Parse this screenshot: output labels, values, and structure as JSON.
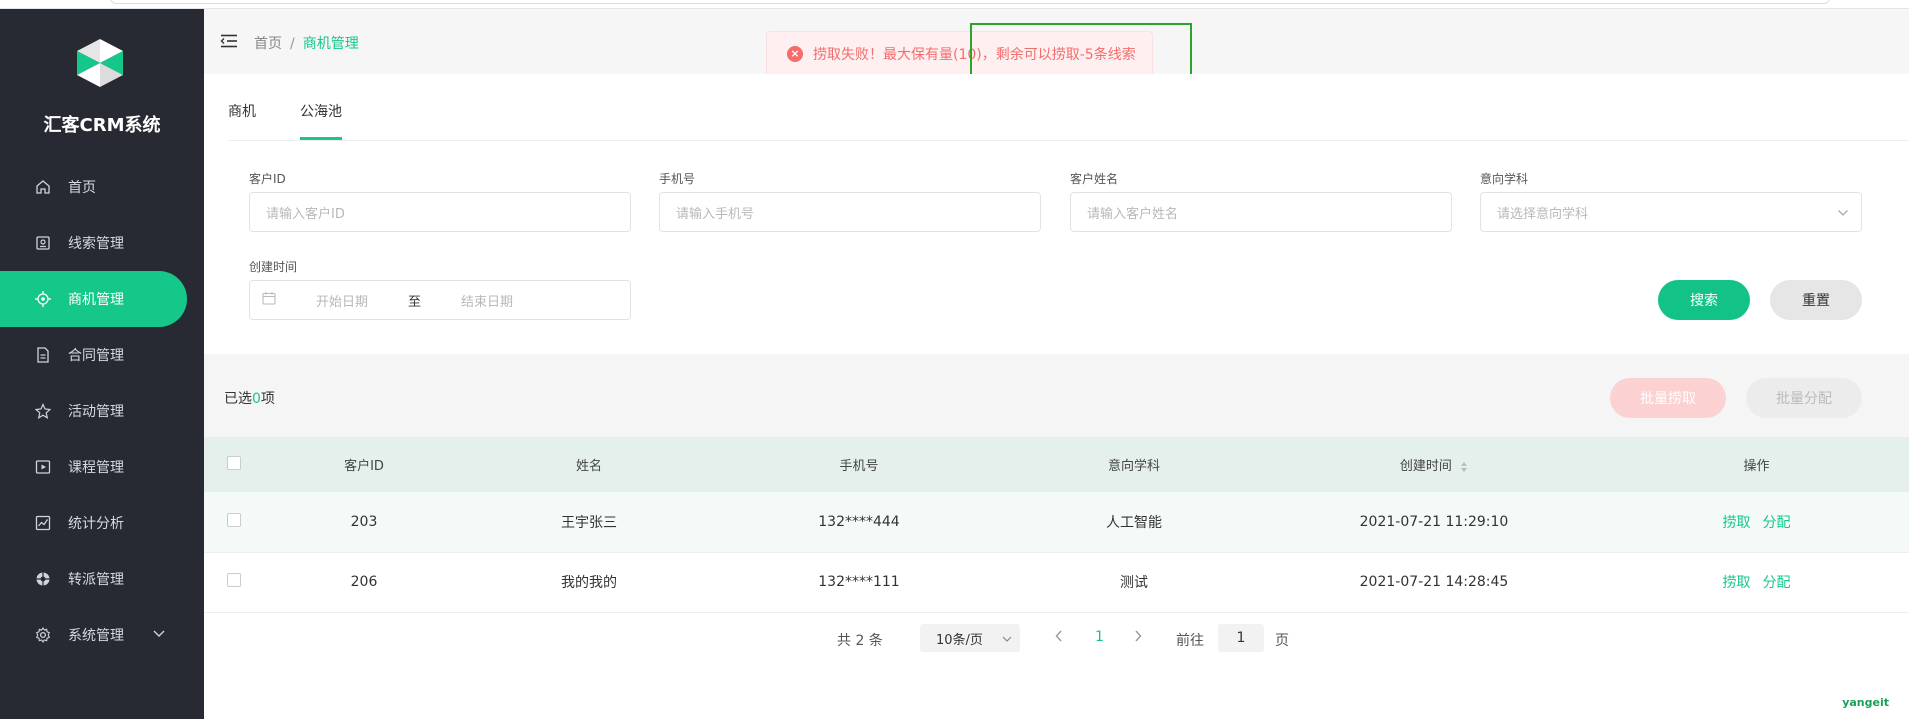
{
  "app": {
    "brand": "汇客CRM系统"
  },
  "sidebar": {
    "items": [
      {
        "label": "首页",
        "icon": "home-icon"
      },
      {
        "label": "线索管理",
        "icon": "clue-icon"
      },
      {
        "label": "商机管理",
        "icon": "target-icon",
        "active": true
      },
      {
        "label": "合同管理",
        "icon": "document-icon"
      },
      {
        "label": "活动管理",
        "icon": "star-icon"
      },
      {
        "label": "课程管理",
        "icon": "video-icon"
      },
      {
        "label": "统计分析",
        "icon": "chart-icon"
      },
      {
        "label": "转派管理",
        "icon": "transfer-icon"
      },
      {
        "label": "系统管理",
        "icon": "gear-icon"
      }
    ]
  },
  "header": {
    "breadcrumb": [
      "首页",
      "商机管理"
    ],
    "separator": "/"
  },
  "toast": {
    "message": "捞取失败！最大保有量(10)，剩余可以捞取-5条线索",
    "icon": "error-icon",
    "color": "#f56c6c"
  },
  "tabs": [
    {
      "label": "商机"
    },
    {
      "label": "公海池",
      "active": true
    }
  ],
  "filters": {
    "customer_id": {
      "label": "客户ID",
      "placeholder": "请输入客户ID"
    },
    "phone": {
      "label": "手机号",
      "placeholder": "请输入手机号"
    },
    "name": {
      "label": "客户姓名",
      "placeholder": "请输入客户姓名"
    },
    "subject": {
      "label": "意向学科",
      "placeholder": "请选择意向学科"
    },
    "created": {
      "label": "创建时间",
      "start_placeholder": "开始日期",
      "end_placeholder": "结束日期",
      "to": "至"
    },
    "search_label": "搜索",
    "reset_label": "重置"
  },
  "list": {
    "selected_prefix": "已选",
    "selected_count": "0",
    "selected_suffix": "项",
    "batch_grab_label": "批量捞取",
    "batch_assign_label": "批量分配",
    "columns": [
      "客户ID",
      "姓名",
      "手机号",
      "意向学科",
      "创建时间",
      "操作"
    ],
    "rows": [
      {
        "id": "203",
        "name": "王宇张三",
        "phone": "132****444",
        "subject": "人工智能",
        "created": "2021-07-21 11:29:10",
        "op_grab": "捞取",
        "op_assign": "分配"
      },
      {
        "id": "206",
        "name": "我的我的",
        "phone": "132****111",
        "subject": "测试",
        "created": "2021-07-21 14:28:45",
        "op_grab": "捞取",
        "op_assign": "分配"
      }
    ]
  },
  "pager": {
    "total": "共 2 条",
    "page_size": "10条/页",
    "current_page": "1",
    "goto_label": "前往",
    "goto_value": "1",
    "page_unit": "页"
  },
  "watermark": "yangeit",
  "colors": {
    "accent": "#15c889",
    "sidebar_bg": "#272a33",
    "error": "#f56c6c"
  }
}
